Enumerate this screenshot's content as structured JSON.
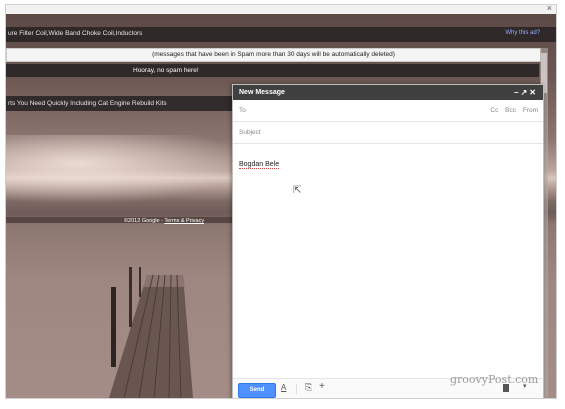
{
  "ads": {
    "top_ad": "ure Filter Coil,Wide Band Choke Coil,Inductors",
    "why_link": "Why this ad?",
    "second_ad": "rts You Need Quickly Including Cat Engine Rebuild Kits"
  },
  "spam": {
    "notice": "(messages that have been in Spam more than 30 days will be automatically deleted)",
    "status": "Hooray, no spam here!"
  },
  "footer": {
    "copyright": "©2012 Google - ",
    "terms": "Terms & Privacy"
  },
  "compose": {
    "title": "New Message",
    "to_label": "To",
    "cc": "Cc",
    "bcc": "Bcc",
    "from": "From",
    "subject_placeholder": "Subject",
    "body": "Bogdan Bele",
    "send_label": "Send",
    "format_icon": "A",
    "attach_icon": "paperclip-icon",
    "insert_icon": "+"
  },
  "watermark": "groovyPost.com",
  "colors": {
    "send": "#4d90fe",
    "header": "#404040"
  }
}
